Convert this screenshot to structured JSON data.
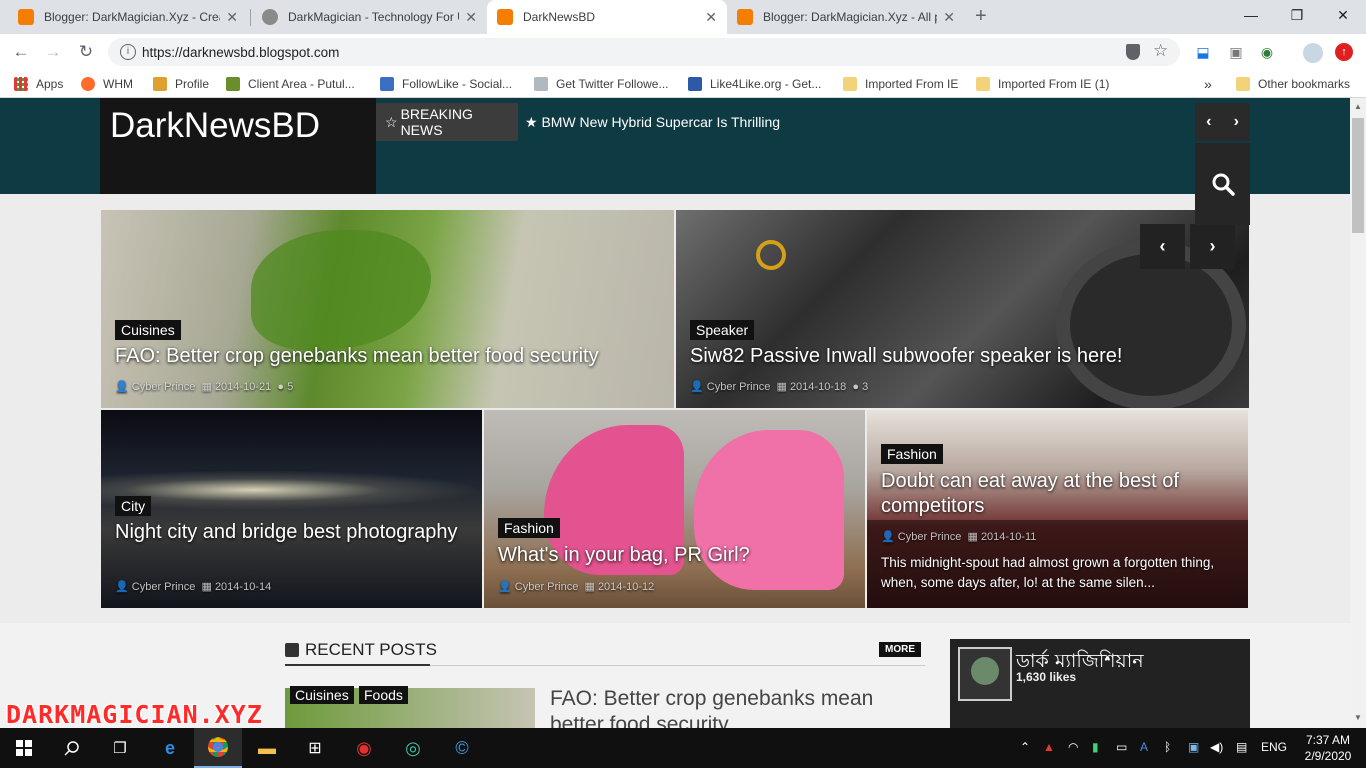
{
  "browser": {
    "tabs": [
      {
        "title": "Blogger: DarkMagician.Xyz - Crea",
        "favicon_color": "#f57d00"
      },
      {
        "title": "DarkMagician - Technology For U",
        "favicon_color": "#8a8a8a"
      },
      {
        "title": "DarkNewsBD",
        "favicon_color": "#f57d00"
      },
      {
        "title": "Blogger: DarkMagician.Xyz - All p",
        "favicon_color": "#f57d00"
      }
    ],
    "new_tab": "+",
    "window_controls": {
      "minimize": "—",
      "maximize": "❐",
      "close": "✕"
    },
    "url": "https://darknewsbd.blogspot.com",
    "bookmarks": [
      {
        "label": "Apps",
        "icon": "apps-grid-icon"
      },
      {
        "label": "WHM",
        "icon": "cpanel-icon"
      },
      {
        "label": "Profile",
        "icon": "profile-icon"
      },
      {
        "label": "Client Area - Putul...",
        "icon": "client-area-icon"
      },
      {
        "label": "FollowLike - Social...",
        "icon": "followlike-icon"
      },
      {
        "label": "Get Twitter Followe...",
        "icon": "twitter-followers-icon"
      },
      {
        "label": "Like4Like.org - Get...",
        "icon": "like-icon"
      },
      {
        "label": "Imported From IE",
        "icon": "folder-icon"
      },
      {
        "label": "Imported From IE (1)",
        "icon": "folder-icon"
      }
    ],
    "bookmarks_overflow": "»",
    "other_bookmarks": "Other bookmarks"
  },
  "site": {
    "logo": "DarkNewsBD",
    "breaking_label": "BREAKING NEWS",
    "breaking_headline": "★ BMW New Hybrid Supercar Is Thrilling",
    "prev": "‹",
    "next": "›"
  },
  "featured_posts": [
    {
      "category": "Cuisines",
      "title": "FAO: Better crop genebanks mean better food security",
      "author": "Cyber Prince",
      "date": "2014-10-21",
      "comments": "5"
    },
    {
      "category": "Speaker",
      "title": "Siw82 Passive Inwall subwoofer speaker is here!",
      "author": "Cyber Prince",
      "date": "2014-10-18",
      "comments": "3"
    },
    {
      "category": "City",
      "title": "Night city and bridge best photography",
      "author": "Cyber Prince",
      "date": "2014-10-14"
    },
    {
      "category": "Fashion",
      "title": "What's in your bag, PR Girl?",
      "author": "Cyber Prince",
      "date": "2014-10-12"
    },
    {
      "category": "Fashion",
      "title": "Doubt can eat away at the best of competitors",
      "author": "Cyber Prince",
      "date": "2014-10-11",
      "excerpt": "This midnight-spout had almost grown a forgotten thing, when, some days after, lo! at the same silen..."
    }
  ],
  "recent": {
    "heading": "RECENT POSTS",
    "more": "MORE",
    "first_tags": [
      "Cuisines",
      "Foods"
    ],
    "first_title": "FAO: Better crop genebanks mean better food security"
  },
  "facebook": {
    "page_name": "ডার্ক ম্যাজিশিয়ান",
    "likes": "1,630 likes"
  },
  "watermark": "DARKMAGICIAN.XYZ",
  "taskbar": {
    "time": "7:37 AM",
    "date": "2/9/2020",
    "lang": "ENG"
  },
  "colors": {
    "header_bg": "#0e3a44",
    "accent_dark": "#111111",
    "blogger_orange": "#f57d00"
  }
}
